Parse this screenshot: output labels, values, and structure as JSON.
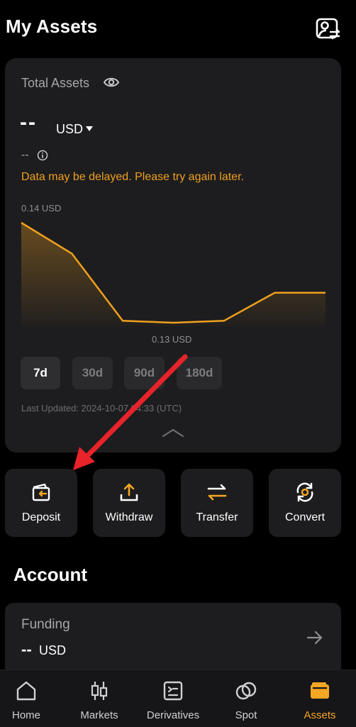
{
  "header": {
    "title": "My Assets",
    "profile_icon": "profile-switch-icon"
  },
  "assets_card": {
    "total_label": "Total Assets",
    "total_value": "--",
    "currency": "USD",
    "pnl_value": "--",
    "delay_notice": "Data may be delayed. Please try again later.",
    "chart_max_label": "0.14 USD",
    "chart_min_label": "0.13 USD",
    "ranges": [
      "7d",
      "30d",
      "90d",
      "180d"
    ],
    "active_range": "7d",
    "last_updated": "Last Updated: 2024-10-07 04:33 (UTC)",
    "colors": {
      "line": "#f0a01e",
      "warning": "#f0a01e"
    }
  },
  "chart_data": {
    "type": "area",
    "x": [
      "d1",
      "d2",
      "d3",
      "d4",
      "d5",
      "d6",
      "d7"
    ],
    "values": [
      0.14,
      0.1369,
      0.1302,
      0.13,
      0.1302,
      0.133,
      0.133
    ],
    "ylim": [
      0.13,
      0.14
    ],
    "title": "",
    "xlabel": "",
    "ylabel": "",
    "annotations": [
      "0.14 USD",
      "0.13 USD"
    ]
  },
  "actions": [
    {
      "label": "Deposit",
      "icon": "deposit-icon"
    },
    {
      "label": "Withdraw",
      "icon": "withdraw-icon"
    },
    {
      "label": "Transfer",
      "icon": "transfer-icon"
    },
    {
      "label": "Convert",
      "icon": "convert-icon"
    }
  ],
  "account": {
    "heading": "Account",
    "funding": {
      "label": "Funding",
      "value": "--",
      "currency": "USD"
    }
  },
  "bottom_nav": [
    {
      "label": "Home",
      "icon": "home-icon"
    },
    {
      "label": "Markets",
      "icon": "candlestick-icon"
    },
    {
      "label": "Derivatives",
      "icon": "derivatives-icon"
    },
    {
      "label": "Spot",
      "icon": "spot-icon"
    },
    {
      "label": "Assets",
      "icon": "wallet-icon"
    }
  ],
  "active_nav": "Assets",
  "accent_color": "#f5a623"
}
